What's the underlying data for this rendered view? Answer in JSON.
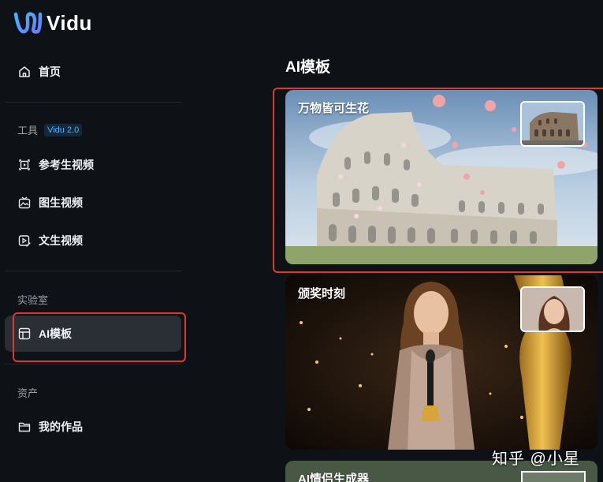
{
  "app": {
    "name": "Vidu"
  },
  "sidebar": {
    "home": "首页",
    "tools_label": "工具",
    "tools_badge": "Vidu 2.0",
    "tools": [
      "参考生视频",
      "图生视频",
      "文生视频"
    ],
    "lab_label": "实验室",
    "lab_item": "AI模板",
    "assets_label": "资产",
    "assets_item": "我的作品"
  },
  "main": {
    "title": "AI模板",
    "cards": [
      {
        "title": "万物皆可生花"
      },
      {
        "title": "颁奖时刻"
      },
      {
        "title": "AI情侣生成器"
      }
    ]
  },
  "watermark": "知乎 @小星",
  "colors": {
    "accent": "#4fb3ff",
    "highlight": "#e0392b",
    "background": "#0e1116"
  }
}
